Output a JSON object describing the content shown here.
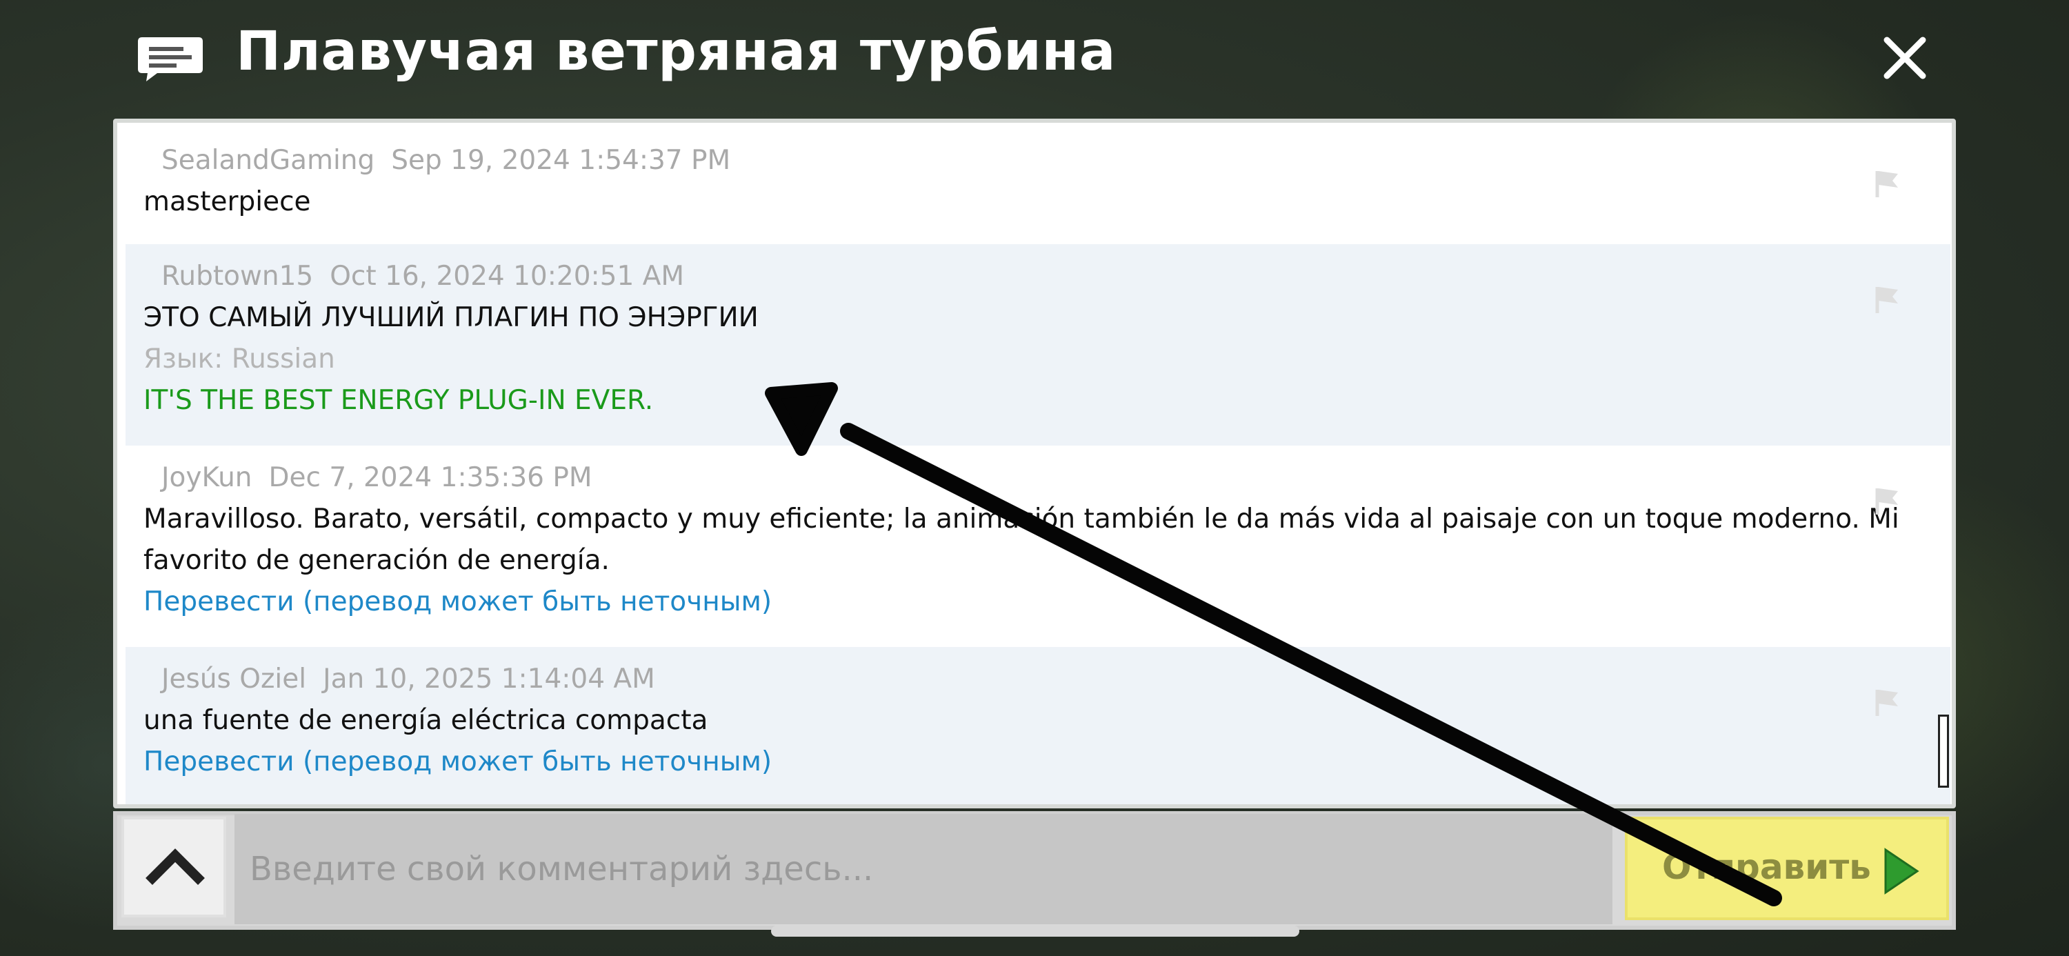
{
  "window": {
    "title": "Плавучая ветряная турбина"
  },
  "comments": [
    {
      "author": "SealandGaming",
      "date": "Sep 19, 2024 1:54:37 PM",
      "text": "masterpiece"
    },
    {
      "author": "Rubtown15",
      "date": "Oct 16, 2024 10:20:51 AM",
      "text": "ЭТО САМЫЙ ЛУЧШИЙ  ПЛАГИН ПО ЭНЭРГИИ",
      "language": "Язык: Russian",
      "translation": "IT'S THE BEST ENERGY PLUG-IN EVER."
    },
    {
      "author": "JoyKun",
      "date": "Dec 7, 2024 1:35:36 PM",
      "text_line1": "Maravilloso. Barato, versátil, compacto y muy eficiente; la animación también le da más vida al paisaje con un toque moderno. Mi",
      "text_line2": "favorito de generación de energía.",
      "translate_link": "Перевести (перевод может быть неточным)"
    },
    {
      "author": "Jesús Oziel",
      "date": "Jan 10, 2025 1:14:04 AM",
      "text": "una fuente de energía eléctrica compacta",
      "translate_link": "Перевести (перевод может быть неточным)"
    }
  ],
  "input": {
    "placeholder": "Введите свой комментарий здесь..."
  },
  "send_button": {
    "label": "Отправить"
  },
  "icons": {
    "dialog": "speech-bubble-icon",
    "close": "close-icon",
    "flag": "flag-icon",
    "expand": "chevron-up-icon",
    "send": "play-arrow-icon"
  },
  "colors": {
    "translation_text": "#1a9a1a",
    "translate_link": "#1e88c8",
    "send_button_bg": "#f4ee7e",
    "send_arrow": "#2e9b2e"
  }
}
